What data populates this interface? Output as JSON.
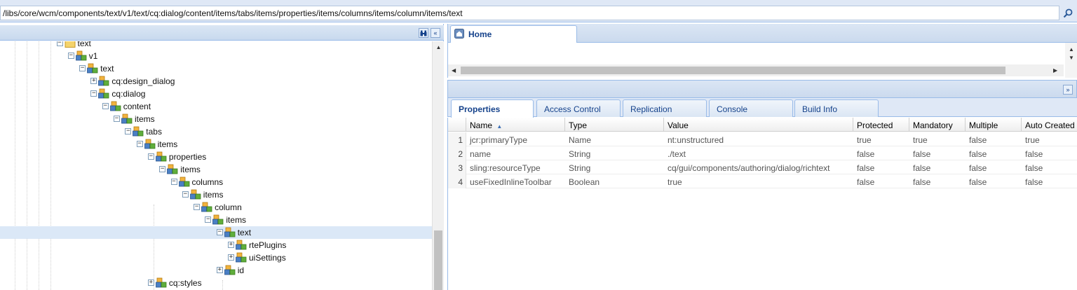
{
  "path_bar": {
    "value": "/libs/core/wcm/components/text/v1/text/cq:dialog/content/items/tabs/items/properties/items/columns/items/column/items/text",
    "search_icon": "search-icon"
  },
  "tree": {
    "header_tools": [
      "binoculars-icon",
      "collapse-left-icon"
    ],
    "nodes": [
      {
        "label": "text",
        "icon": "folder-icon",
        "expander": "−",
        "selected": false
      },
      {
        "label": "v1",
        "icon": "node-icon",
        "expander": "−",
        "selected": false
      },
      {
        "label": "text",
        "icon": "node-icon",
        "expander": "−",
        "selected": false
      },
      {
        "label": "cq:design_dialog",
        "icon": "node-icon",
        "expander": "+",
        "selected": false
      },
      {
        "label": "cq:dialog",
        "icon": "node-icon",
        "expander": "−",
        "selected": false
      },
      {
        "label": "content",
        "icon": "node-icon",
        "expander": "−",
        "selected": false
      },
      {
        "label": "items",
        "icon": "node-icon",
        "expander": "−",
        "selected": false
      },
      {
        "label": "tabs",
        "icon": "node-icon",
        "expander": "−",
        "selected": false
      },
      {
        "label": "items",
        "icon": "node-icon",
        "expander": "−",
        "selected": false
      },
      {
        "label": "properties",
        "icon": "node-icon",
        "expander": "−",
        "selected": false
      },
      {
        "label": "items",
        "icon": "node-icon",
        "expander": "−",
        "selected": false
      },
      {
        "label": "columns",
        "icon": "node-icon",
        "expander": "−",
        "selected": false
      },
      {
        "label": "items",
        "icon": "node-icon",
        "expander": "−",
        "selected": false
      },
      {
        "label": "column",
        "icon": "node-icon",
        "expander": "−",
        "selected": false
      },
      {
        "label": "items",
        "icon": "node-icon",
        "expander": "−",
        "selected": false
      },
      {
        "label": "text",
        "icon": "node-icon",
        "expander": "−",
        "selected": true
      },
      {
        "label": "rtePlugins",
        "icon": "node-icon",
        "expander": "+",
        "selected": false
      },
      {
        "label": "uiSettings",
        "icon": "node-icon",
        "expander": "+",
        "selected": false
      },
      {
        "label": "id",
        "icon": "node-icon",
        "expander": "+",
        "selected": false
      },
      {
        "label": "cq:styles",
        "icon": "node-icon",
        "expander": "+",
        "selected": false
      }
    ]
  },
  "home": {
    "tab_label": "Home",
    "tab_icon": "home-icon"
  },
  "properties": {
    "tabs": [
      "Properties",
      "Access Control",
      "Replication",
      "Console",
      "Build Info"
    ],
    "active_tab": "Properties",
    "columns": [
      "Name",
      "Type",
      "Value",
      "Protected",
      "Mandatory",
      "Multiple",
      "Auto Created"
    ],
    "sort_indicator": "▲",
    "rows": [
      {
        "num": "1",
        "name": "jcr:primaryType",
        "type": "Name",
        "value": "nt:unstructured",
        "protected": "true",
        "mandatory": "true",
        "multiple": "false",
        "auto_created": "true"
      },
      {
        "num": "2",
        "name": "name",
        "type": "String",
        "value": "./text",
        "protected": "false",
        "mandatory": "false",
        "multiple": "false",
        "auto_created": "false"
      },
      {
        "num": "3",
        "name": "sling:resourceType",
        "type": "String",
        "value": "cq/gui/components/authoring/dialog/richtext",
        "protected": "false",
        "mandatory": "false",
        "multiple": "false",
        "auto_created": "false"
      },
      {
        "num": "4",
        "name": "useFixedInlineToolbar",
        "type": "Boolean",
        "value": "true",
        "protected": "false",
        "mandatory": "false",
        "multiple": "false",
        "auto_created": "false"
      }
    ]
  },
  "colors": {
    "panel_border": "#99bbe8",
    "tab_text": "#15428b",
    "selected_row": "#dbe8f7"
  }
}
